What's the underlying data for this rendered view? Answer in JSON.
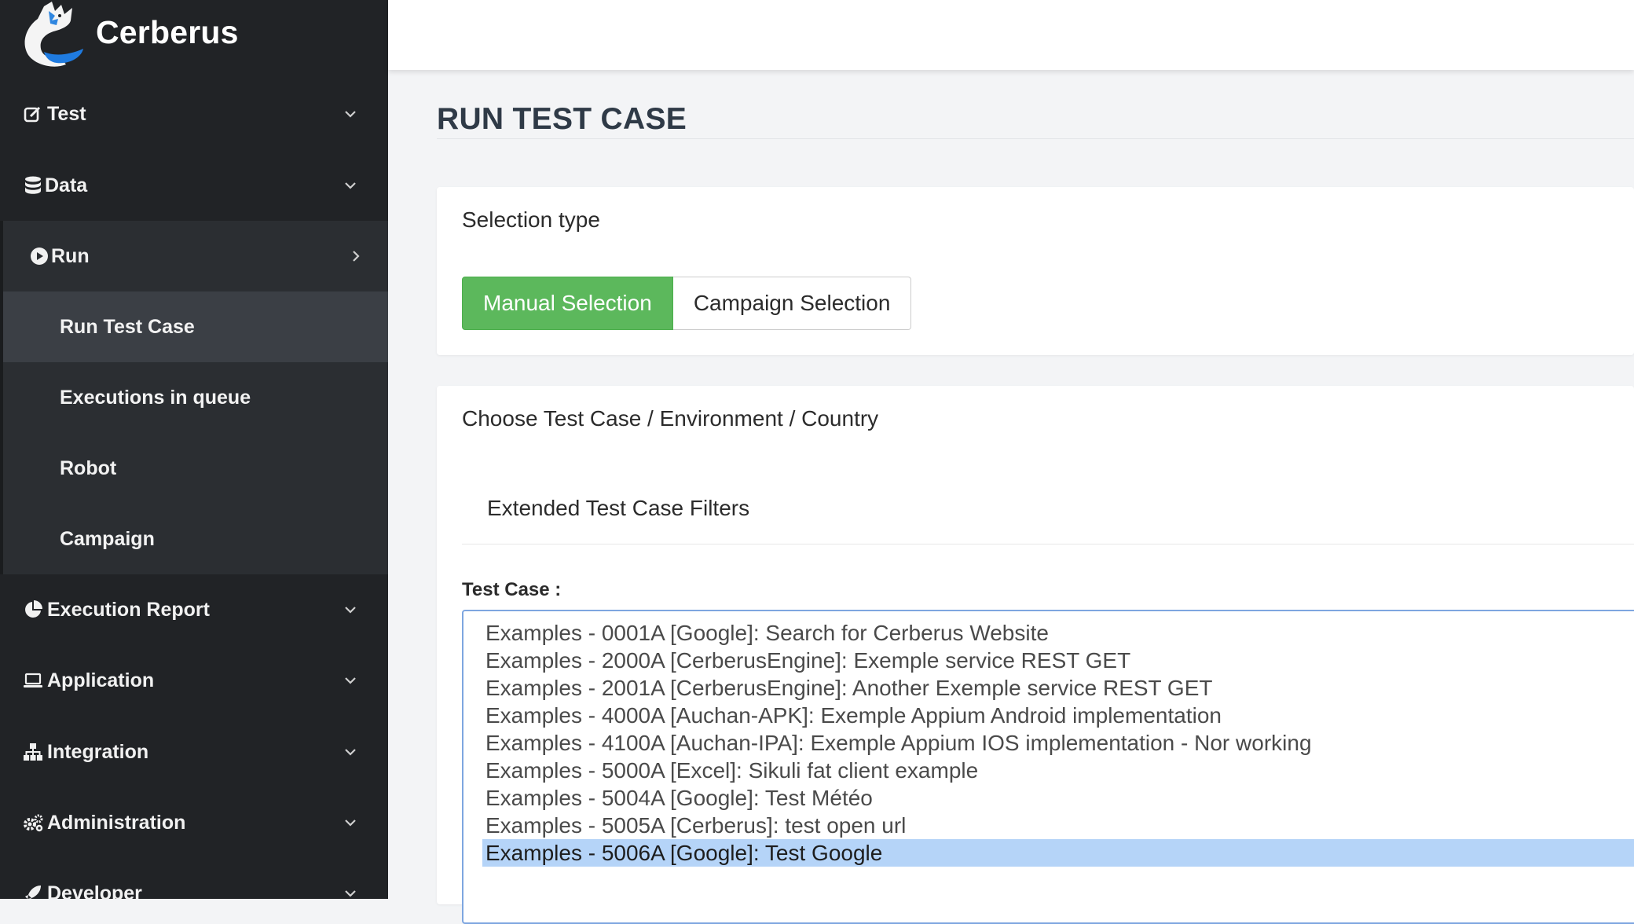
{
  "brand": {
    "name": "Cerberus"
  },
  "sidebar": {
    "items": [
      {
        "label": "Test",
        "icon": "edit-icon"
      },
      {
        "label": "Data",
        "icon": "database-icon"
      },
      {
        "label": "Run",
        "icon": "play-circle-icon"
      },
      {
        "label": "Execution Report",
        "icon": "pie-chart-icon"
      },
      {
        "label": "Application",
        "icon": "laptop-icon"
      },
      {
        "label": "Integration",
        "icon": "sitemap-icon"
      },
      {
        "label": "Administration",
        "icon": "gears-icon"
      },
      {
        "label": "Developer",
        "icon": "rocket-icon"
      }
    ],
    "run_subitems": [
      {
        "label": "Run Test Case",
        "active": true
      },
      {
        "label": "Executions in queue"
      },
      {
        "label": "Robot"
      },
      {
        "label": "Campaign"
      }
    ]
  },
  "main": {
    "title": "RUN TEST CASE",
    "selection": {
      "heading": "Selection type",
      "manual_label": "Manual Selection",
      "campaign_label": "Campaign Selection"
    },
    "choose": {
      "heading": "Choose Test Case / Environment / Country",
      "extended_filters": "Extended Test Case Filters",
      "test_case_label": "Test Case :",
      "options": [
        "Examples - 0001A [Google]: Search for Cerberus Website",
        "Examples - 2000A [CerberusEngine]: Exemple service REST GET",
        "Examples - 2001A [CerberusEngine]: Another Exemple service REST GET",
        "Examples - 4000A [Auchan-APK]: Exemple Appium Android implementation",
        "Examples - 4100A [Auchan-IPA]: Exemple Appium IOS implementation - Nor working",
        "Examples - 5000A [Excel]: Sikuli fat client example",
        "Examples - 5004A [Google]: Test Météo",
        "Examples - 5005A [Cerberus]: test open url",
        "Examples - 5006A [Google]: Test Google"
      ],
      "selected_index": 8
    }
  },
  "colors": {
    "sidebar_bg": "#212326",
    "accent_green": "#5cb85c",
    "selection_blue": "#b5d4f8"
  }
}
